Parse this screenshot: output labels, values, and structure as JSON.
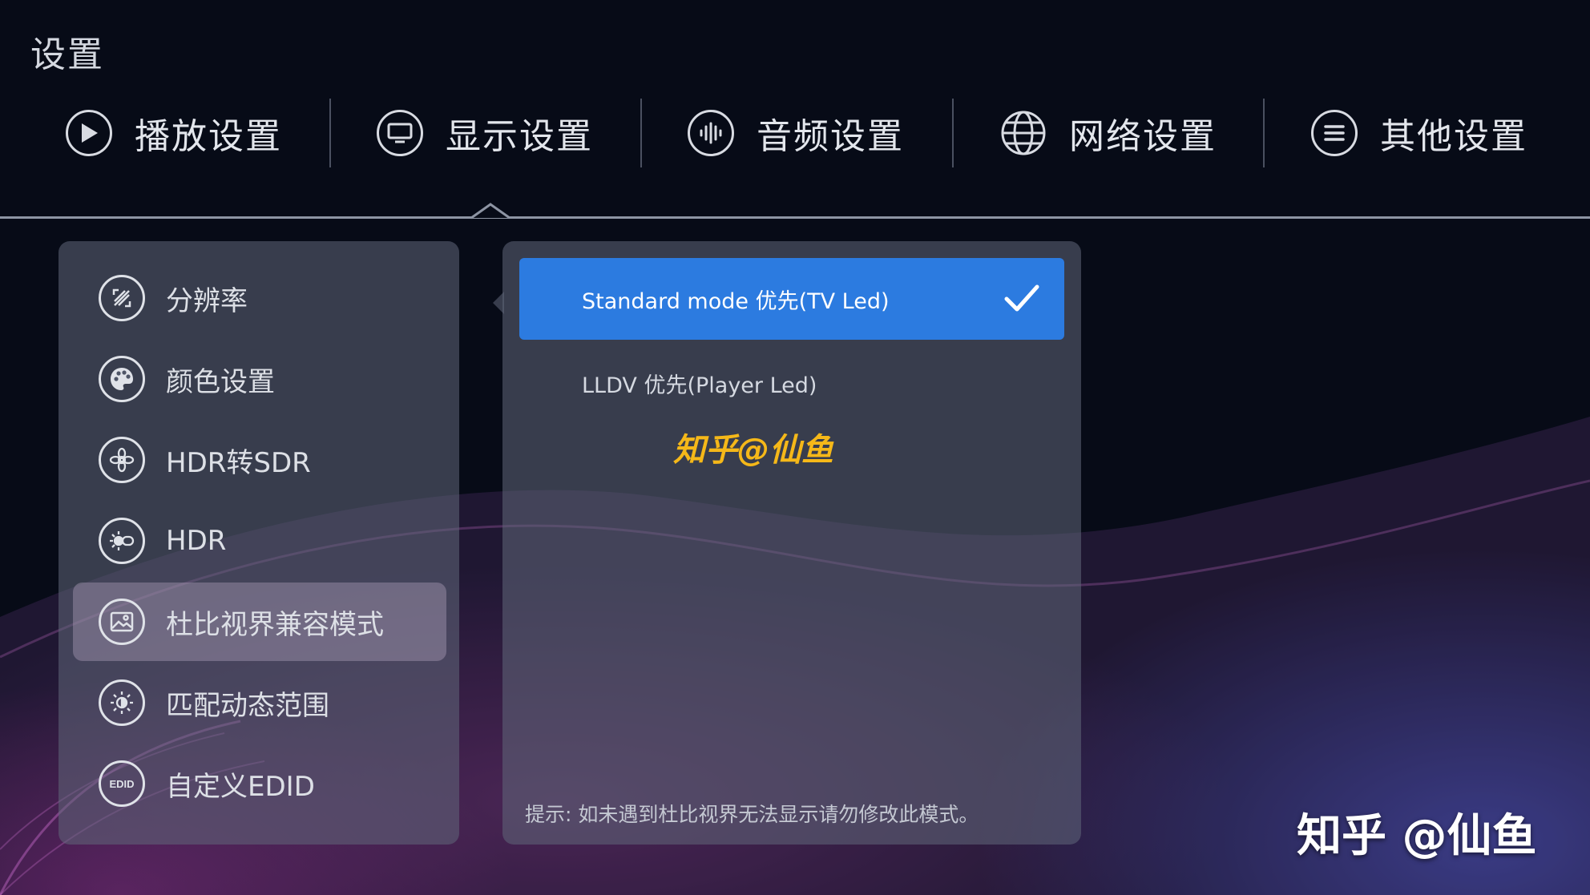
{
  "page": {
    "title": "设置"
  },
  "tabs": [
    {
      "label": "播放设置",
      "icon": "play-icon"
    },
    {
      "label": "显示设置",
      "icon": "monitor-icon"
    },
    {
      "label": "音频设置",
      "icon": "audio-wave-icon"
    },
    {
      "label": "网络设置",
      "icon": "globe-icon"
    },
    {
      "label": "其他设置",
      "icon": "menu-lines-icon"
    }
  ],
  "active_tab": "显示设置",
  "menu": {
    "items": [
      {
        "label": "分辨率",
        "icon": "resolution-icon"
      },
      {
        "label": "颜色设置",
        "icon": "palette-icon"
      },
      {
        "label": "HDR转SDR",
        "icon": "aperture-icon"
      },
      {
        "label": "HDR",
        "icon": "hdr-sun-icon"
      },
      {
        "label": "杜比视界兼容模式",
        "icon": "image-icon"
      },
      {
        "label": "匹配动态范围",
        "icon": "brightness-icon"
      },
      {
        "label": "自定义EDID",
        "icon": "edid-icon",
        "icon_text": "EDID"
      }
    ],
    "selected": "杜比视界兼容模式"
  },
  "options": {
    "items": [
      {
        "label": "Standard mode 优先(TV Led)",
        "checked": true
      },
      {
        "label": "LLDV 优先(Player Led)",
        "checked": false
      }
    ],
    "watermark": "知乎@仙鱼",
    "hint": "提示: 如未遇到杜比视界无法显示请勿修改此模式。"
  },
  "watermark": "知乎 @仙鱼",
  "colors": {
    "accent": "#2c7be0",
    "background": "#070b17",
    "panel": "#60687a",
    "watermark_inner": "#f5b819"
  }
}
